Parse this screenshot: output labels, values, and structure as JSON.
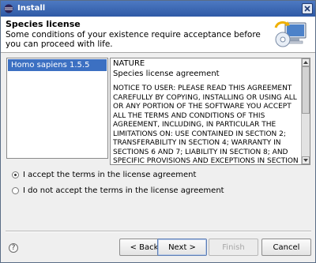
{
  "window": {
    "title": "Install"
  },
  "header": {
    "title": "Species license",
    "description": "Some conditions of your existence require acceptance before you can proceed with life."
  },
  "species_list": {
    "items": [
      "Homo sapiens 1.5.5"
    ],
    "selected_index": 0
  },
  "license": {
    "heading": "NATURE",
    "subheading": "Species license agreement",
    "body_lines": [
      "NOTICE TO USER: PLEASE READ THIS AGREEMENT",
      "CAREFULLY BY COPYING, INSTALLING OR USING ALL",
      "OR ANY PORTION OF THE SOFTWARE YOU ACCEPT",
      "ALL THE TERMS AND CONDITIONS OF THIS",
      "AGREEMENT, INCLUDING, IN PARTICULAR THE",
      "LIMITATIONS ON: USE CONTAINED IN SECTION 2;",
      "TRANSFERABILITY IN SECTION 4; WARRANTY IN",
      "SECTIONS 6 AND 7; LIABILITY IN SECTION 8; AND",
      "SPECIFIC PROVISIONS AND EXCEPTIONS IN SECTION"
    ]
  },
  "options": {
    "accept_label": "I accept the terms in the license agreement",
    "decline_label": "I do not accept the terms in the license agreement",
    "selected": "accept"
  },
  "buttons": {
    "back": "< Back",
    "next": "Next >",
    "finish": "Finish",
    "cancel": "Cancel"
  },
  "icons": {
    "app": "eclipse-icon",
    "close": "close-icon",
    "wizard": "install-wizard-icon",
    "help": "help-icon"
  }
}
